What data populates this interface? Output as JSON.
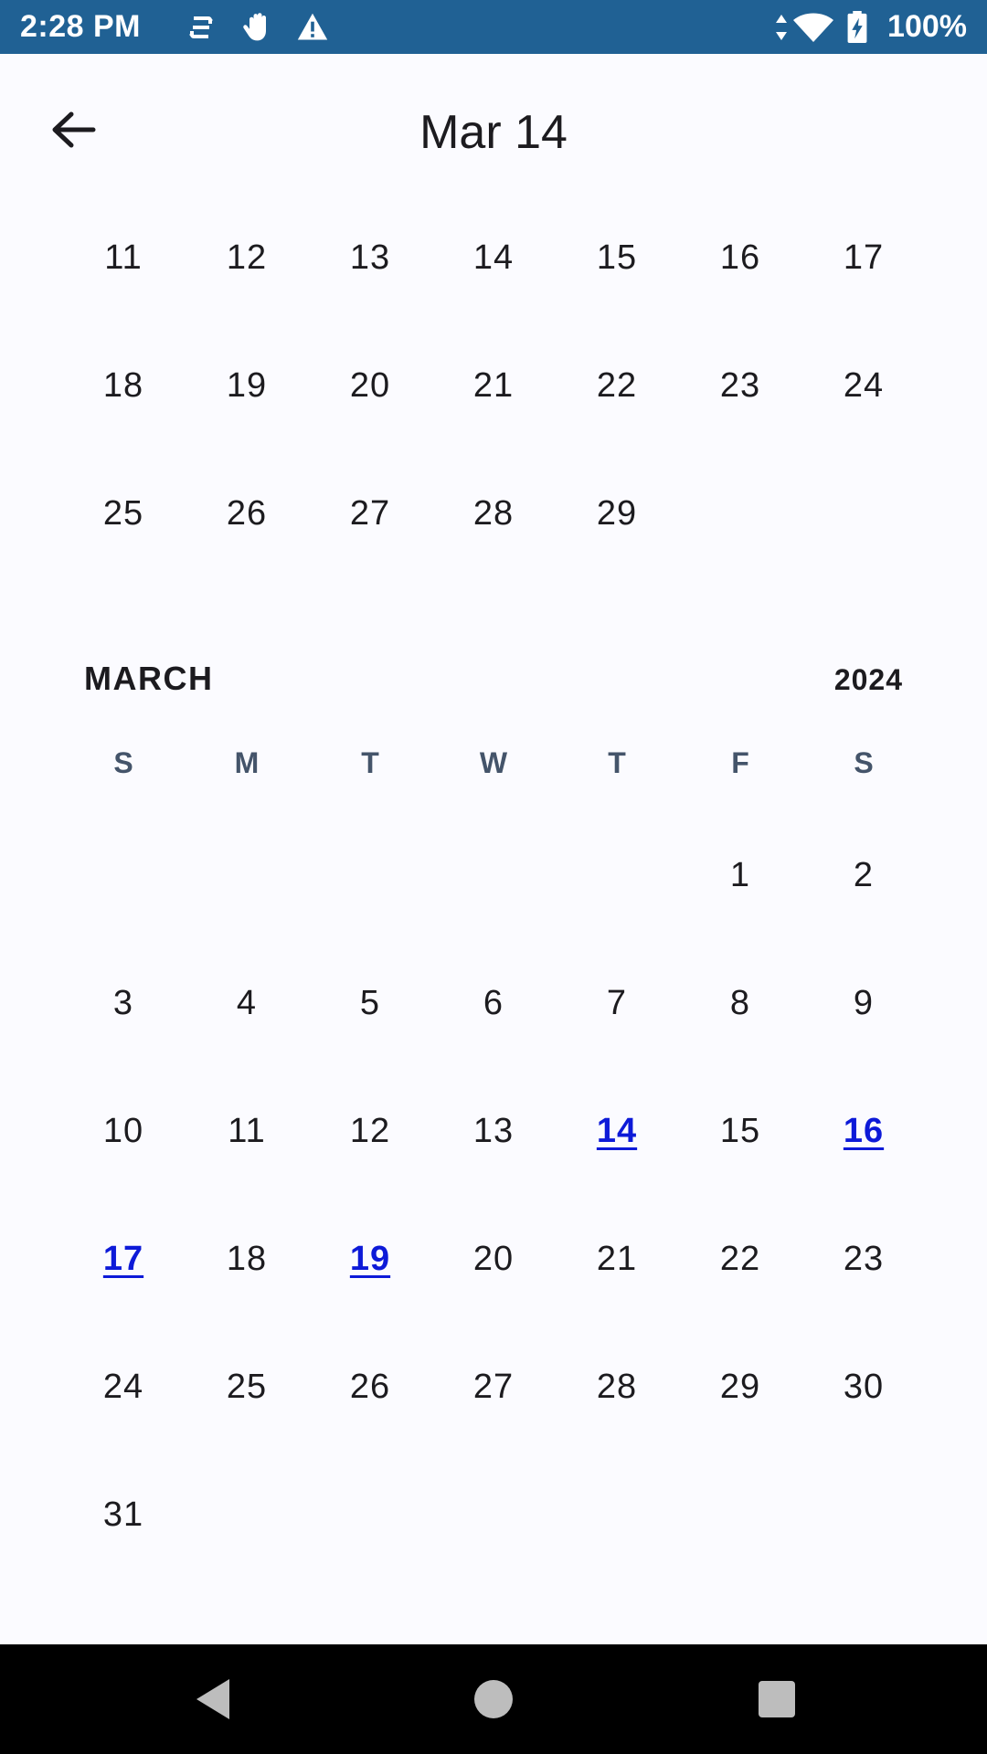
{
  "status_bar": {
    "time": "2:28 PM",
    "icons": [
      "sync-icon",
      "hand-icon",
      "warning-icon",
      "data-arrows-icon",
      "wifi-icon",
      "battery-charging-icon"
    ],
    "battery": "100%"
  },
  "header": {
    "back_icon": "arrow-back-icon",
    "title": "Mar 14"
  },
  "prev_month": {
    "weeks": [
      [
        "11",
        "12",
        "13",
        "14",
        "15",
        "16",
        "17"
      ],
      [
        "18",
        "19",
        "20",
        "21",
        "22",
        "23",
        "24"
      ],
      [
        "25",
        "26",
        "27",
        "28",
        "29",
        "",
        ""
      ]
    ]
  },
  "march": {
    "month": "MARCH",
    "year": "2024",
    "weekdays": [
      "S",
      "M",
      "T",
      "W",
      "T",
      "F",
      "S"
    ],
    "weeks": [
      [
        "",
        "",
        "",
        "",
        "",
        "1",
        "2"
      ],
      [
        "3",
        "4",
        "5",
        "6",
        "7",
        "8",
        "9"
      ],
      [
        "10",
        "11",
        "12",
        "13",
        "14",
        "15",
        "16"
      ],
      [
        "17",
        "18",
        "19",
        "20",
        "21",
        "22",
        "23"
      ],
      [
        "24",
        "25",
        "26",
        "27",
        "28",
        "29",
        "30"
      ],
      [
        "31",
        "",
        "",
        "",
        "",
        "",
        ""
      ]
    ],
    "event_days": [
      "14",
      "16",
      "17",
      "19"
    ],
    "event_color": "#0d1ad8"
  },
  "nav_bar": {
    "icons": [
      "back-triangle-icon",
      "home-circle-icon",
      "recents-square-icon"
    ]
  }
}
